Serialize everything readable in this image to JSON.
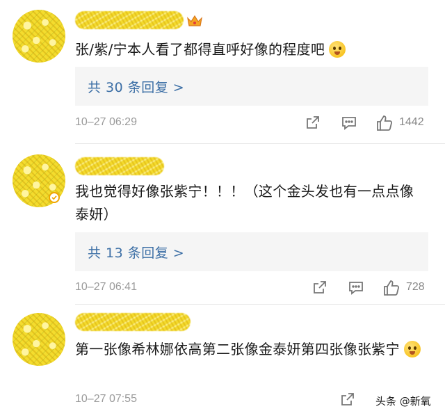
{
  "comments": [
    {
      "text": "张/紫/宁本人看了都得直呼好像的程度吧",
      "emoji": "drooling-face-emoji",
      "replies": "共 30 条回复 >",
      "time": "10–27 06:29",
      "likes": "1442",
      "has_crown": true,
      "verified": false
    },
    {
      "text": "我也觉得好像张紫宁！！！（这个金头发也有一点点像泰妍）",
      "emoji": "",
      "replies": "共 13 条回复 >",
      "time": "10–27 06:41",
      "likes": "728",
      "has_crown": false,
      "verified": true
    },
    {
      "text": "第一张像希林娜依高第二张像金泰妍第四张像张紫宁",
      "emoji": "laughing-tears-emoji",
      "replies": "",
      "time": "10–27 07:55",
      "likes": "",
      "has_crown": false,
      "verified": false
    }
  ],
  "watermark": "头条 @新氧",
  "colors": {
    "link": "#3b6ea5",
    "reply_bg": "#f5f5f5",
    "meta": "#9a9a9a",
    "avatar_blur": "#f4dc2e"
  },
  "icons": [
    "share-icon",
    "comment-icon",
    "like-icon",
    "crown-icon",
    "verified-icon"
  ]
}
